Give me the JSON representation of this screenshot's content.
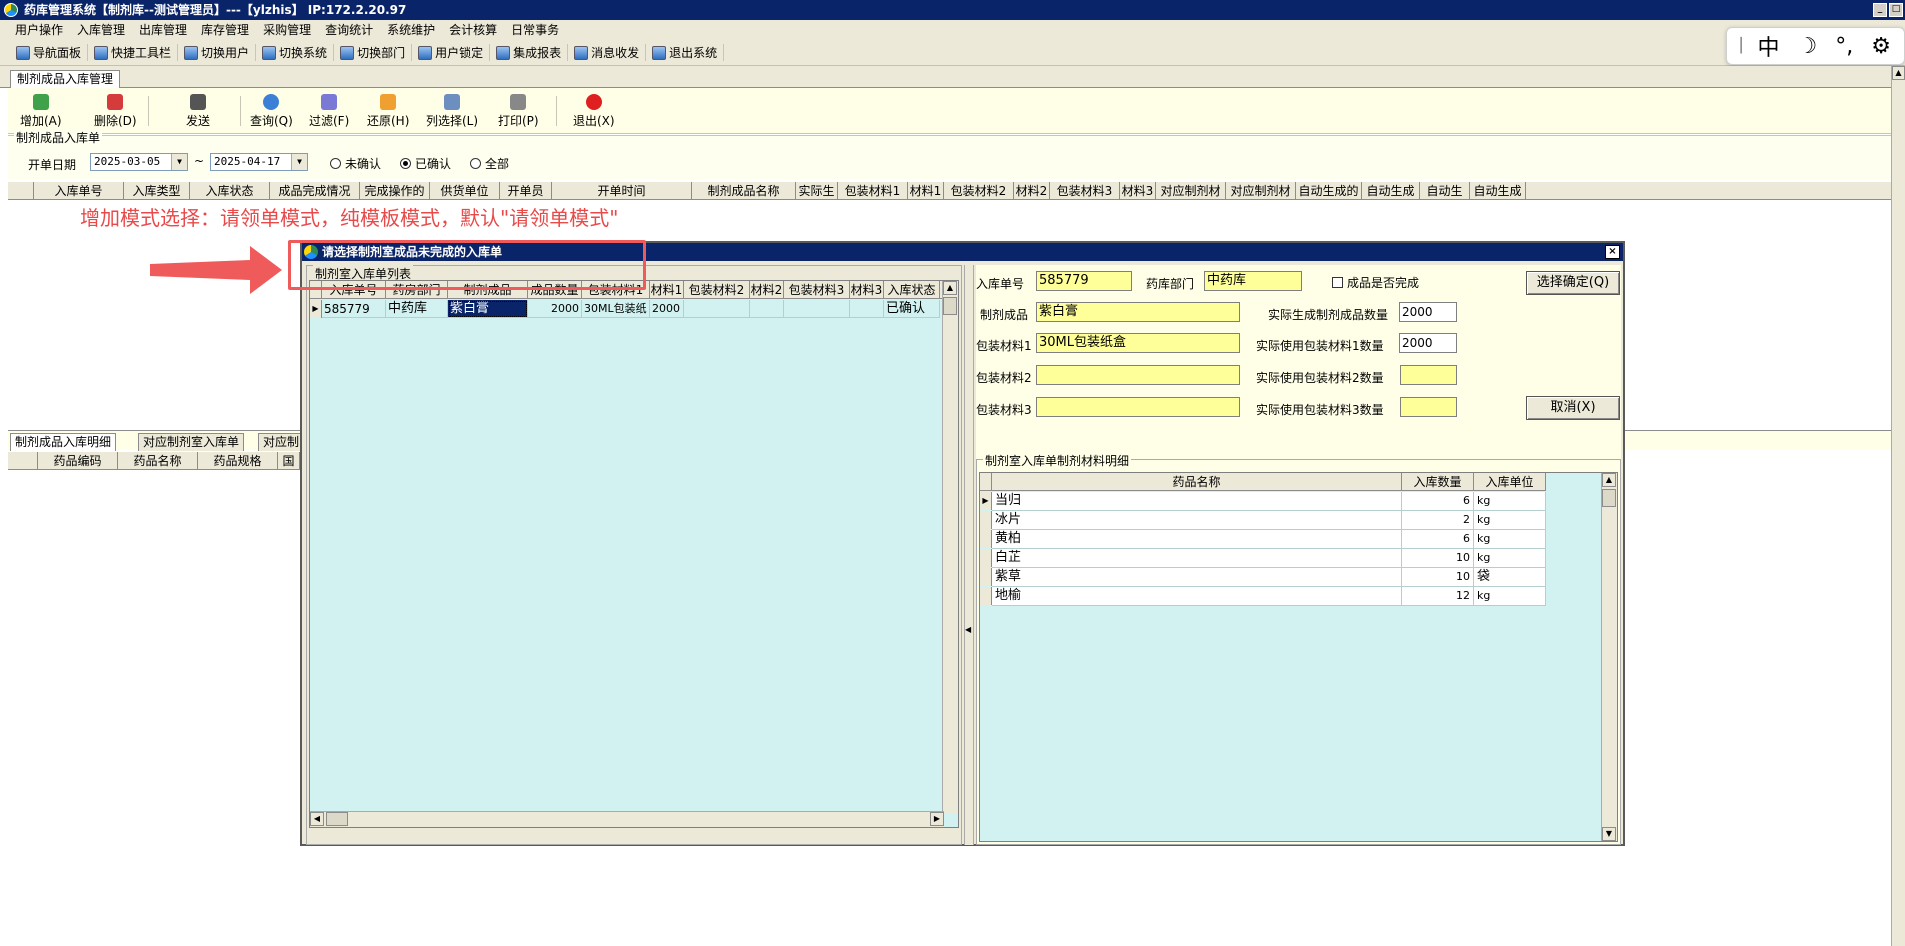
{
  "window": {
    "title": "药库管理系统【制剂库--测试管理员】---【ylzhis】 IP:172.2.20.97"
  },
  "menu": [
    "用户操作",
    "入库管理",
    "出库管理",
    "库存管理",
    "采购管理",
    "查询统计",
    "系统维护",
    "会计核算",
    "日常事务"
  ],
  "quickbar": [
    {
      "label": "导航面板",
      "icon": "navigation-icon"
    },
    {
      "label": "快捷工具栏",
      "icon": "tools-icon"
    },
    {
      "label": "切换用户",
      "icon": "switch-user-icon"
    },
    {
      "label": "切换系统",
      "icon": "switch-system-icon"
    },
    {
      "label": "切换部门",
      "icon": "switch-dept-icon"
    },
    {
      "label": "用户锁定",
      "icon": "user-lock-icon"
    },
    {
      "label": "集成报表",
      "icon": "report-icon"
    },
    {
      "label": "消息收发",
      "icon": "message-icon"
    },
    {
      "label": "退出系统",
      "icon": "exit-icon"
    }
  ],
  "ime": {
    "mode": "中",
    "moon": "☽",
    "punct": "°,",
    "gear": "⚙"
  },
  "tab": {
    "label": "制剂成品入库管理"
  },
  "toolbar": {
    "add": "增加(A)",
    "delete": "删除(D)",
    "send": "发送",
    "query": "查询(Q)",
    "filter": "过滤(F)",
    "restore": "还原(H)",
    "columns": "列选择(L)",
    "print": "打印(P)",
    "exit": "退出(X)"
  },
  "filter": {
    "group_title": "制剂成品入库单",
    "date_label": "开单日期",
    "date_from": "2025-03-05",
    "tilde": "~",
    "date_to": "2025-04-17",
    "radio_unconfirmed": "未确认",
    "radio_confirmed": "已确认",
    "radio_all": "全部"
  },
  "main_grid_headers": [
    "入库单号",
    "入库类型",
    "入库状态",
    "成品完成情况",
    "完成操作的",
    "供货单位",
    "开单员",
    "开单时间",
    "制剂成品名称",
    "实际生",
    "包装材料1",
    "材料1",
    "包装材料2",
    "材料2",
    "包装材料3",
    "材料3",
    "对应制剂材",
    "对应制剂材",
    "自动生成的",
    "自动生成",
    "自动生",
    "自动生成"
  ],
  "annotation": "增加模式选择：请领单模式，纯模板模式，默认\"请领单模式\"",
  "lower_tabs": [
    "制剂成品入库明细",
    "对应制剂室入库单",
    "对应制"
  ],
  "lower_grid_headers": [
    "药品编码",
    "药品名称",
    "药品规格",
    "国"
  ],
  "dialog": {
    "title": "请选择制剂室成品未完成的入库单",
    "close": "×",
    "left_group_title": "制剂室入库单列表",
    "left_headers": [
      "入库单号",
      "药房部门",
      "制剂成品",
      "成品数量",
      "包装材料1",
      "材料1",
      "包装材料2",
      "材料2",
      "包装材料3",
      "材料3",
      "入库状态"
    ],
    "left_rows": [
      [
        "585779",
        "中药库",
        "紫白膏",
        "2000",
        "30ML包装纸",
        "2000",
        "",
        "",
        "",
        "",
        "已确认"
      ]
    ],
    "fields": {
      "order_no_label": "入库单号",
      "order_no": "585779",
      "dept_label": "药库部门",
      "dept": "中药库",
      "completed_label": "成品是否完成",
      "product_label": "制剂成品",
      "product": "紫白膏",
      "actual_qty_label": "实际生成制剂成品数量",
      "actual_qty": "2000",
      "pkg1_label": "包装材料1",
      "pkg1": "30ML包装纸盒",
      "pkg1_qty_label": "实际使用包装材料1数量",
      "pkg1_qty": "2000",
      "pkg2_label": "包装材料2",
      "pkg2": "",
      "pkg2_qty_label": "实际使用包装材料2数量",
      "pkg2_qty": "",
      "pkg3_label": "包装材料3",
      "pkg3": "",
      "pkg3_qty_label": "实际使用包装材料3数量",
      "pkg3_qty": ""
    },
    "confirm_button": "选择确定(Q)",
    "cancel_button": "取消(X)",
    "detail_group_title": "制剂室入库单制剂材料明细",
    "detail_headers": [
      "药品名称",
      "入库数量",
      "入库单位"
    ],
    "detail_rows": [
      [
        "当归",
        "6",
        "kg"
      ],
      [
        "冰片",
        "2",
        "kg"
      ],
      [
        "黄柏",
        "6",
        "kg"
      ],
      [
        "白芷",
        "10",
        "kg"
      ],
      [
        "紫草",
        "10",
        "袋"
      ],
      [
        "地榆",
        "12",
        "kg"
      ]
    ]
  },
  "colors": {
    "titlebar": "#0a246a",
    "annotation": "#e84a4a",
    "grid_bg": "#d2f2f1",
    "field_bg": "#ffff99",
    "toolbar_bg": "#ffffe8"
  }
}
